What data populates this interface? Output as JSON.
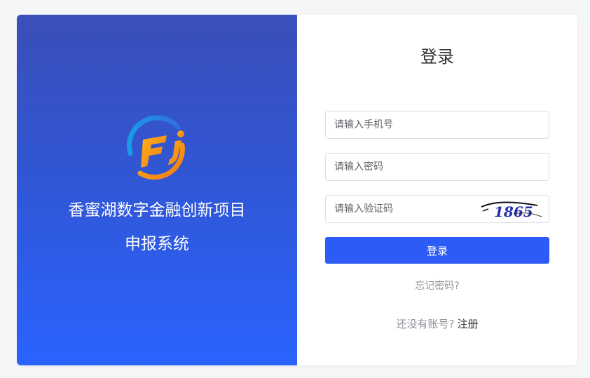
{
  "brand": {
    "title_line1": "香蜜湖数字金融创新项目",
    "title_line2": "申报系统",
    "logo_icon": "fj-logo-icon",
    "colors": {
      "gradient_top": "#3a4fb8",
      "gradient_bottom": "#2a63ff",
      "logo_blue": "#2f86e8",
      "logo_orange": "#f59a1b"
    }
  },
  "login_form": {
    "title": "登录",
    "phone_placeholder": "请输入手机号",
    "password_placeholder": "请输入密码",
    "captcha_placeholder": "请输入验证码",
    "captcha_text": "1865",
    "submit_label": "登录",
    "forgot_password": "忘记密码?",
    "no_account_prompt": "还没有账号?",
    "register_label": "注册",
    "colors": {
      "primary_button": "#2c5cf5"
    }
  }
}
